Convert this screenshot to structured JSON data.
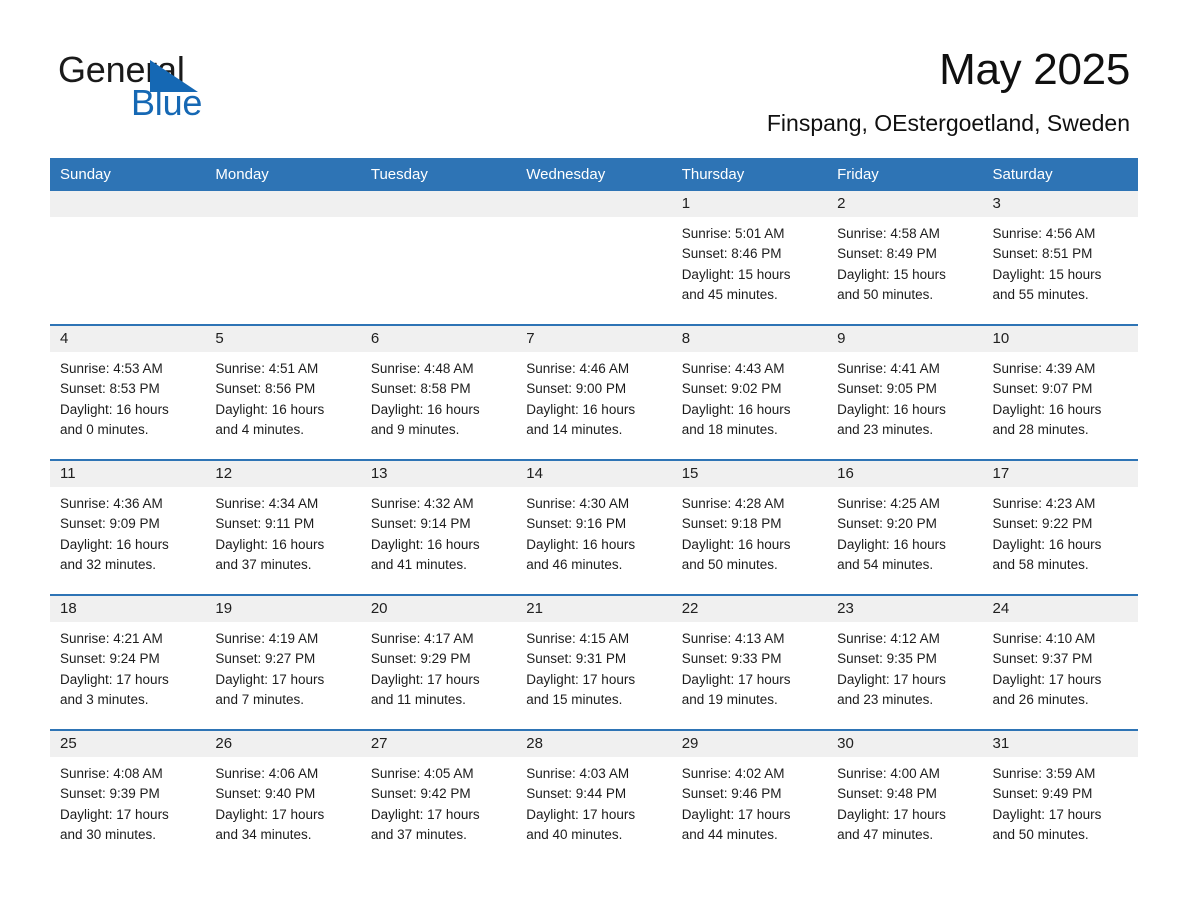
{
  "brand": {
    "name_part1": "General",
    "name_part2": "Blue",
    "accent_color": "#1568b4",
    "header_color": "#2e74b5"
  },
  "header": {
    "month_title": "May 2025",
    "location": "Finspang, OEstergoetland, Sweden"
  },
  "calendar": {
    "weekday_headers": [
      "Sunday",
      "Monday",
      "Tuesday",
      "Wednesday",
      "Thursday",
      "Friday",
      "Saturday"
    ],
    "weeks": [
      [
        {
          "date": "",
          "blank": true
        },
        {
          "date": "",
          "blank": true
        },
        {
          "date": "",
          "blank": true
        },
        {
          "date": "",
          "blank": true
        },
        {
          "date": "1",
          "sunrise": "Sunrise: 5:01 AM",
          "sunset": "Sunset: 8:46 PM",
          "daylight": "Daylight: 15 hours and 45 minutes."
        },
        {
          "date": "2",
          "sunrise": "Sunrise: 4:58 AM",
          "sunset": "Sunset: 8:49 PM",
          "daylight": "Daylight: 15 hours and 50 minutes."
        },
        {
          "date": "3",
          "sunrise": "Sunrise: 4:56 AM",
          "sunset": "Sunset: 8:51 PM",
          "daylight": "Daylight: 15 hours and 55 minutes."
        }
      ],
      [
        {
          "date": "4",
          "sunrise": "Sunrise: 4:53 AM",
          "sunset": "Sunset: 8:53 PM",
          "daylight": "Daylight: 16 hours and 0 minutes."
        },
        {
          "date": "5",
          "sunrise": "Sunrise: 4:51 AM",
          "sunset": "Sunset: 8:56 PM",
          "daylight": "Daylight: 16 hours and 4 minutes."
        },
        {
          "date": "6",
          "sunrise": "Sunrise: 4:48 AM",
          "sunset": "Sunset: 8:58 PM",
          "daylight": "Daylight: 16 hours and 9 minutes."
        },
        {
          "date": "7",
          "sunrise": "Sunrise: 4:46 AM",
          "sunset": "Sunset: 9:00 PM",
          "daylight": "Daylight: 16 hours and 14 minutes."
        },
        {
          "date": "8",
          "sunrise": "Sunrise: 4:43 AM",
          "sunset": "Sunset: 9:02 PM",
          "daylight": "Daylight: 16 hours and 18 minutes."
        },
        {
          "date": "9",
          "sunrise": "Sunrise: 4:41 AM",
          "sunset": "Sunset: 9:05 PM",
          "daylight": "Daylight: 16 hours and 23 minutes."
        },
        {
          "date": "10",
          "sunrise": "Sunrise: 4:39 AM",
          "sunset": "Sunset: 9:07 PM",
          "daylight": "Daylight: 16 hours and 28 minutes."
        }
      ],
      [
        {
          "date": "11",
          "sunrise": "Sunrise: 4:36 AM",
          "sunset": "Sunset: 9:09 PM",
          "daylight": "Daylight: 16 hours and 32 minutes."
        },
        {
          "date": "12",
          "sunrise": "Sunrise: 4:34 AM",
          "sunset": "Sunset: 9:11 PM",
          "daylight": "Daylight: 16 hours and 37 minutes."
        },
        {
          "date": "13",
          "sunrise": "Sunrise: 4:32 AM",
          "sunset": "Sunset: 9:14 PM",
          "daylight": "Daylight: 16 hours and 41 minutes."
        },
        {
          "date": "14",
          "sunrise": "Sunrise: 4:30 AM",
          "sunset": "Sunset: 9:16 PM",
          "daylight": "Daylight: 16 hours and 46 minutes."
        },
        {
          "date": "15",
          "sunrise": "Sunrise: 4:28 AM",
          "sunset": "Sunset: 9:18 PM",
          "daylight": "Daylight: 16 hours and 50 minutes."
        },
        {
          "date": "16",
          "sunrise": "Sunrise: 4:25 AM",
          "sunset": "Sunset: 9:20 PM",
          "daylight": "Daylight: 16 hours and 54 minutes."
        },
        {
          "date": "17",
          "sunrise": "Sunrise: 4:23 AM",
          "sunset": "Sunset: 9:22 PM",
          "daylight": "Daylight: 16 hours and 58 minutes."
        }
      ],
      [
        {
          "date": "18",
          "sunrise": "Sunrise: 4:21 AM",
          "sunset": "Sunset: 9:24 PM",
          "daylight": "Daylight: 17 hours and 3 minutes."
        },
        {
          "date": "19",
          "sunrise": "Sunrise: 4:19 AM",
          "sunset": "Sunset: 9:27 PM",
          "daylight": "Daylight: 17 hours and 7 minutes."
        },
        {
          "date": "20",
          "sunrise": "Sunrise: 4:17 AM",
          "sunset": "Sunset: 9:29 PM",
          "daylight": "Daylight: 17 hours and 11 minutes."
        },
        {
          "date": "21",
          "sunrise": "Sunrise: 4:15 AM",
          "sunset": "Sunset: 9:31 PM",
          "daylight": "Daylight: 17 hours and 15 minutes."
        },
        {
          "date": "22",
          "sunrise": "Sunrise: 4:13 AM",
          "sunset": "Sunset: 9:33 PM",
          "daylight": "Daylight: 17 hours and 19 minutes."
        },
        {
          "date": "23",
          "sunrise": "Sunrise: 4:12 AM",
          "sunset": "Sunset: 9:35 PM",
          "daylight": "Daylight: 17 hours and 23 minutes."
        },
        {
          "date": "24",
          "sunrise": "Sunrise: 4:10 AM",
          "sunset": "Sunset: 9:37 PM",
          "daylight": "Daylight: 17 hours and 26 minutes."
        }
      ],
      [
        {
          "date": "25",
          "sunrise": "Sunrise: 4:08 AM",
          "sunset": "Sunset: 9:39 PM",
          "daylight": "Daylight: 17 hours and 30 minutes."
        },
        {
          "date": "26",
          "sunrise": "Sunrise: 4:06 AM",
          "sunset": "Sunset: 9:40 PM",
          "daylight": "Daylight: 17 hours and 34 minutes."
        },
        {
          "date": "27",
          "sunrise": "Sunrise: 4:05 AM",
          "sunset": "Sunset: 9:42 PM",
          "daylight": "Daylight: 17 hours and 37 minutes."
        },
        {
          "date": "28",
          "sunrise": "Sunrise: 4:03 AM",
          "sunset": "Sunset: 9:44 PM",
          "daylight": "Daylight: 17 hours and 40 minutes."
        },
        {
          "date": "29",
          "sunrise": "Sunrise: 4:02 AM",
          "sunset": "Sunset: 9:46 PM",
          "daylight": "Daylight: 17 hours and 44 minutes."
        },
        {
          "date": "30",
          "sunrise": "Sunrise: 4:00 AM",
          "sunset": "Sunset: 9:48 PM",
          "daylight": "Daylight: 17 hours and 47 minutes."
        },
        {
          "date": "31",
          "sunrise": "Sunrise: 3:59 AM",
          "sunset": "Sunset: 9:49 PM",
          "daylight": "Daylight: 17 hours and 50 minutes."
        }
      ]
    ]
  }
}
